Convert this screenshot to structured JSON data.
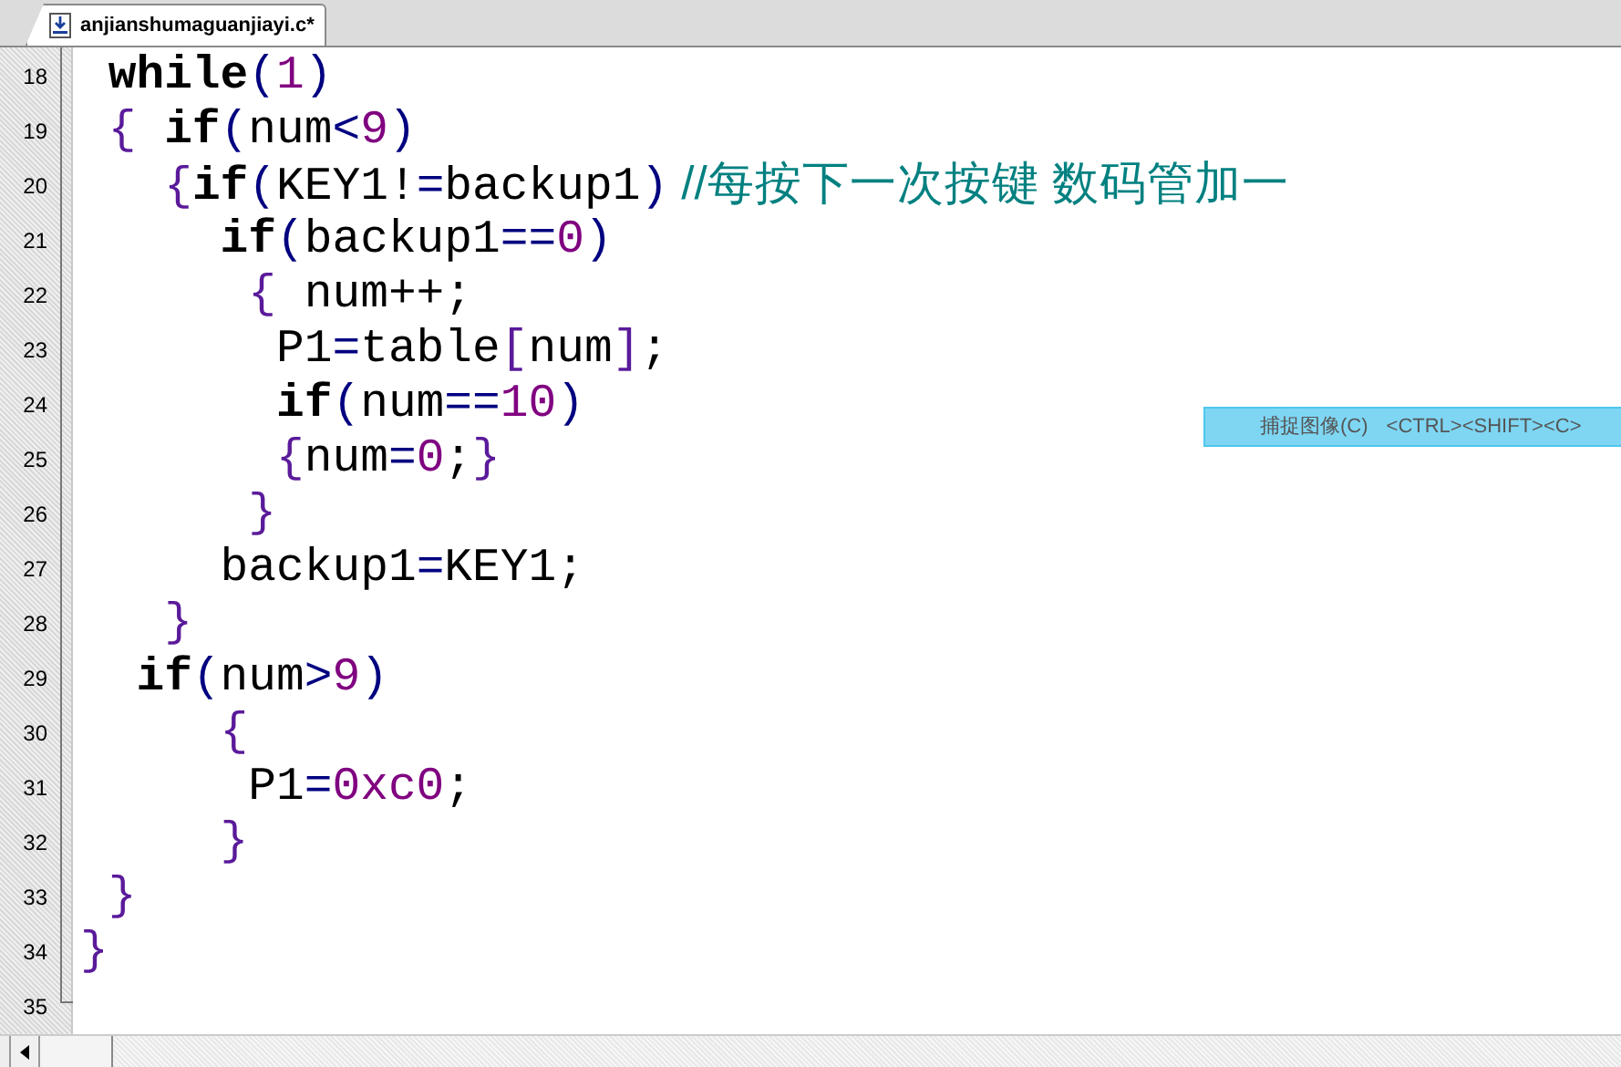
{
  "tab": {
    "title": "anjianshumaguanjiayi.c*",
    "selected": true
  },
  "lines": [
    {
      "number": "18",
      "tokens": [
        {
          "kind": "keyword",
          "text": " while"
        },
        {
          "kind": "op",
          "text": "("
        },
        {
          "kind": "num",
          "text": "1"
        },
        {
          "kind": "op",
          "text": ")"
        }
      ]
    },
    {
      "number": "19",
      "tokens": [
        {
          "kind": "brace",
          "text": " {"
        },
        {
          "kind": "keyword",
          "text": " if"
        },
        {
          "kind": "op",
          "text": "("
        },
        {
          "kind": "plain",
          "text": "num"
        },
        {
          "kind": "op",
          "text": "<"
        },
        {
          "kind": "num",
          "text": "9"
        },
        {
          "kind": "op",
          "text": ")"
        }
      ]
    },
    {
      "number": "20",
      "tokens": [
        {
          "kind": "brace",
          "text": "   {"
        },
        {
          "kind": "keyword",
          "text": "if"
        },
        {
          "kind": "op",
          "text": "("
        },
        {
          "kind": "plain",
          "text": "KEY1!"
        },
        {
          "kind": "op",
          "text": "="
        },
        {
          "kind": "plain",
          "text": "backup1"
        },
        {
          "kind": "op",
          "text": ")"
        },
        {
          "kind": "comment",
          "text": " //每按下一次按键 数码管加一"
        }
      ]
    },
    {
      "number": "21",
      "tokens": [
        {
          "kind": "keyword",
          "text": "     if"
        },
        {
          "kind": "op",
          "text": "("
        },
        {
          "kind": "plain",
          "text": "backup1"
        },
        {
          "kind": "op",
          "text": "=="
        },
        {
          "kind": "num",
          "text": "0"
        },
        {
          "kind": "op",
          "text": ")"
        }
      ]
    },
    {
      "number": "22",
      "tokens": [
        {
          "kind": "brace",
          "text": "      {"
        },
        {
          "kind": "plain",
          "text": " num++;"
        }
      ]
    },
    {
      "number": "23",
      "tokens": [
        {
          "kind": "plain",
          "text": "       P1"
        },
        {
          "kind": "op",
          "text": "="
        },
        {
          "kind": "plain",
          "text": "table"
        },
        {
          "kind": "brace",
          "text": "["
        },
        {
          "kind": "plain",
          "text": "num"
        },
        {
          "kind": "brace",
          "text": "]"
        },
        {
          "kind": "plain",
          "text": ";"
        }
      ]
    },
    {
      "number": "24",
      "tokens": [
        {
          "kind": "keyword",
          "text": "       if"
        },
        {
          "kind": "op",
          "text": "("
        },
        {
          "kind": "plain",
          "text": "num"
        },
        {
          "kind": "op",
          "text": "=="
        },
        {
          "kind": "num",
          "text": "10"
        },
        {
          "kind": "op",
          "text": ")"
        }
      ]
    },
    {
      "number": "25",
      "tokens": [
        {
          "kind": "brace",
          "text": "       {"
        },
        {
          "kind": "plain",
          "text": "num"
        },
        {
          "kind": "op",
          "text": "="
        },
        {
          "kind": "num",
          "text": "0"
        },
        {
          "kind": "plain",
          "text": ";"
        },
        {
          "kind": "brace",
          "text": "}"
        }
      ]
    },
    {
      "number": "26",
      "tokens": [
        {
          "kind": "brace",
          "text": "      }"
        }
      ]
    },
    {
      "number": "27",
      "tokens": [
        {
          "kind": "plain",
          "text": "     backup1"
        },
        {
          "kind": "op",
          "text": "="
        },
        {
          "kind": "plain",
          "text": "KEY1;"
        }
      ]
    },
    {
      "number": "28",
      "tokens": [
        {
          "kind": "brace",
          "text": "   }"
        }
      ]
    },
    {
      "number": "29",
      "tokens": [
        {
          "kind": "keyword",
          "text": "  if"
        },
        {
          "kind": "op",
          "text": "("
        },
        {
          "kind": "plain",
          "text": "num"
        },
        {
          "kind": "op",
          "text": ">"
        },
        {
          "kind": "num",
          "text": "9"
        },
        {
          "kind": "op",
          "text": ")"
        }
      ]
    },
    {
      "number": "30",
      "tokens": [
        {
          "kind": "brace",
          "text": "     {"
        }
      ]
    },
    {
      "number": "31",
      "tokens": [
        {
          "kind": "plain",
          "text": "      P1"
        },
        {
          "kind": "op",
          "text": "="
        },
        {
          "kind": "num",
          "text": "0xc0"
        },
        {
          "kind": "plain",
          "text": ";"
        }
      ]
    },
    {
      "number": "32",
      "tokens": [
        {
          "kind": "brace",
          "text": "     }"
        }
      ]
    },
    {
      "number": "33",
      "tokens": [
        {
          "kind": "brace",
          "text": " }"
        }
      ]
    },
    {
      "number": "34",
      "tokens": [
        {
          "kind": "brace",
          "text": "}"
        }
      ]
    },
    {
      "number": "35"
    }
  ],
  "tooltip": {
    "label": "捕捉图像(C)",
    "shortcut": "<CTRL><SHIFT><C>"
  }
}
